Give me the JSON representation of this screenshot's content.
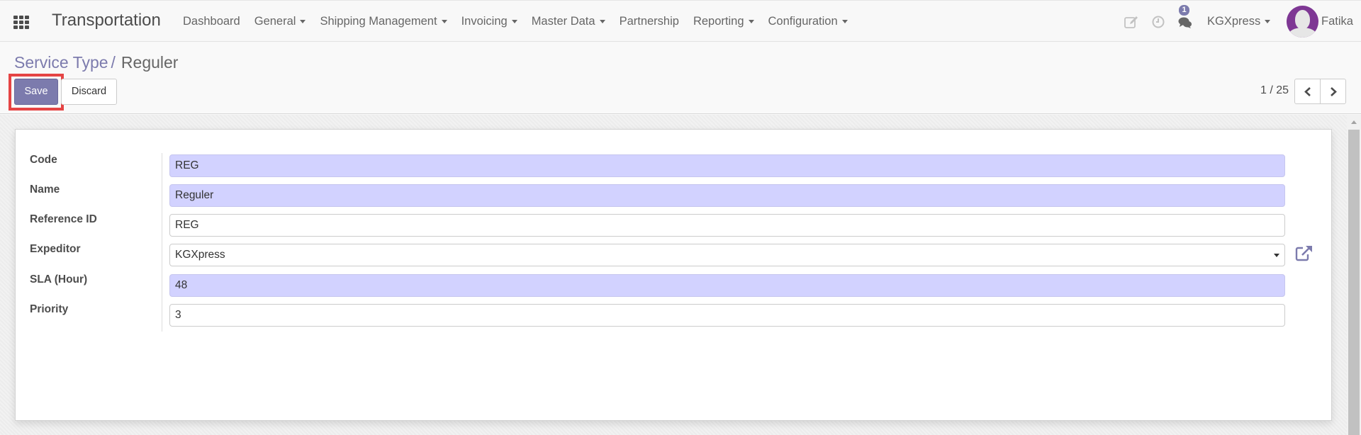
{
  "navbar": {
    "app_title": "Transportation",
    "menu": [
      {
        "label": "Dashboard",
        "dropdown": false
      },
      {
        "label": "General",
        "dropdown": true
      },
      {
        "label": "Shipping Management",
        "dropdown": true
      },
      {
        "label": "Invoicing",
        "dropdown": true
      },
      {
        "label": "Master Data",
        "dropdown": true
      },
      {
        "label": "Partnership",
        "dropdown": false
      },
      {
        "label": "Reporting",
        "dropdown": true
      },
      {
        "label": "Configuration",
        "dropdown": true
      }
    ],
    "systray": {
      "edit_icon": "pencil-square-icon",
      "activity_icon": "clock-icon",
      "messaging_icon": "comments-icon",
      "message_count": "1",
      "company": "KGXpress",
      "user_name": "Fatika"
    }
  },
  "breadcrumb": {
    "parent": "Service Type",
    "separator": "/",
    "current": "Reguler"
  },
  "buttons": {
    "save": "Save",
    "discard": "Discard"
  },
  "pager": {
    "value": "1 / 25"
  },
  "form": {
    "fields": [
      {
        "label": "Code",
        "value": "REG",
        "required": true
      },
      {
        "label": "Name",
        "value": "Reguler",
        "required": true
      },
      {
        "label": "Reference ID",
        "value": "REG",
        "required": false
      },
      {
        "label": "Expeditor",
        "value": "KGXpress",
        "required": false,
        "type": "many2one"
      },
      {
        "label": "SLA (Hour)",
        "value": "48",
        "required": true
      },
      {
        "label": "Priority",
        "value": "3",
        "required": false
      }
    ]
  },
  "colors": {
    "accent": "#7c7bad",
    "required_field": "#d2d2ff",
    "highlight": "#e54444"
  }
}
